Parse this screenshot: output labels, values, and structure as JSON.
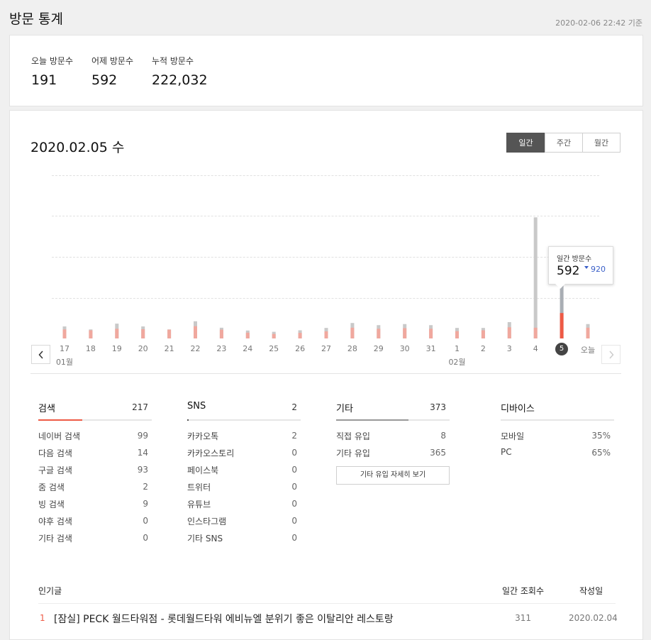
{
  "page": {
    "title": "방문 통계",
    "updated": "2020-02-06 22:42 기준"
  },
  "summary": {
    "today_label": "오늘 방문수",
    "today_value": "191",
    "yesterday_label": "어제 방문수",
    "yesterday_value": "592",
    "total_label": "누적 방문수",
    "total_value": "222,032"
  },
  "chart_header": {
    "date": "2020.02.05 수",
    "periods": [
      "일간",
      "주간",
      "월간"
    ],
    "active_period": "일간"
  },
  "tooltip": {
    "label": "일간 방문수",
    "value": "592",
    "delta": "920",
    "delta_icon": "caret-down-icon"
  },
  "chart_data": {
    "type": "bar",
    "categories": [
      "17",
      "18",
      "19",
      "20",
      "21",
      "22",
      "23",
      "24",
      "25",
      "26",
      "27",
      "28",
      "29",
      "30",
      "31",
      "1",
      "2",
      "3",
      "4",
      "5",
      "오늘"
    ],
    "month_labels": [
      {
        "at": "17",
        "label": "01월"
      },
      {
        "at": "1",
        "label": "02월"
      }
    ],
    "selected": "5",
    "series": [
      {
        "values": [
          210,
          190,
          225,
          215,
          205,
          285,
          205,
          135,
          105,
          130,
          165,
          250,
          225,
          240,
          225,
          170,
          190,
          260,
          250,
          592,
          250
        ]
      },
      {
        "values": [
          280,
          210,
          345,
          280,
          210,
          400,
          250,
          185,
          155,
          190,
          245,
          360,
          310,
          335,
          310,
          245,
          245,
          380,
          2820,
          1512,
          335
        ]
      }
    ],
    "colors": {
      "primary": "#f0a89e",
      "secondary": "#c9c9c9",
      "selected_primary": "#ee5a45",
      "selected_secondary": "#a9aeb4"
    },
    "ylim": [
      0,
      3800
    ],
    "grid": true
  },
  "sources": [
    {
      "name": "검색",
      "count": "217",
      "accent": "#ee5a45",
      "accent_fraction": 0.39,
      "rows": [
        {
          "label": "네이버 검색",
          "value": "99"
        },
        {
          "label": "다음 검색",
          "value": "14"
        },
        {
          "label": "구글 검색",
          "value": "93"
        },
        {
          "label": "줌 검색",
          "value": "2"
        },
        {
          "label": "빙 검색",
          "value": "9"
        },
        {
          "label": "야후 검색",
          "value": "0"
        },
        {
          "label": "기타 검색",
          "value": "0"
        }
      ]
    },
    {
      "name": "SNS",
      "count": "2",
      "accent": "#555555",
      "accent_fraction": 0.01,
      "rows": [
        {
          "label": "카카오톡",
          "value": "2"
        },
        {
          "label": "카카오스토리",
          "value": "0"
        },
        {
          "label": "페이스북",
          "value": "0"
        },
        {
          "label": "트위터",
          "value": "0"
        },
        {
          "label": "유튜브",
          "value": "0"
        },
        {
          "label": "인스타그램",
          "value": "0"
        },
        {
          "label": "기타 SNS",
          "value": "0"
        }
      ]
    },
    {
      "name": "기타",
      "count": "373",
      "accent": "#999999",
      "accent_fraction": 0.64,
      "rows": [
        {
          "label": "직접 유입",
          "value": "8"
        },
        {
          "label": "기타 유입",
          "value": "365"
        }
      ],
      "more_label": "기타 유입 자세히 보기"
    }
  ],
  "devices": {
    "title": "디바이스",
    "rows": [
      {
        "label": "모바일",
        "value": "35%"
      },
      {
        "label": "PC",
        "value": "65%"
      }
    ]
  },
  "popular": {
    "header": {
      "title": "인기글",
      "views": "일간 조회수",
      "date": "작성일"
    },
    "rows": [
      {
        "rank": "1",
        "title": "[잠실] PECK 월드타워점 - 롯데월드타워 에비뉴엘 분위기 좋은 이탈리안 레스토랑",
        "views": "311",
        "date": "2020.02.04"
      }
    ]
  }
}
